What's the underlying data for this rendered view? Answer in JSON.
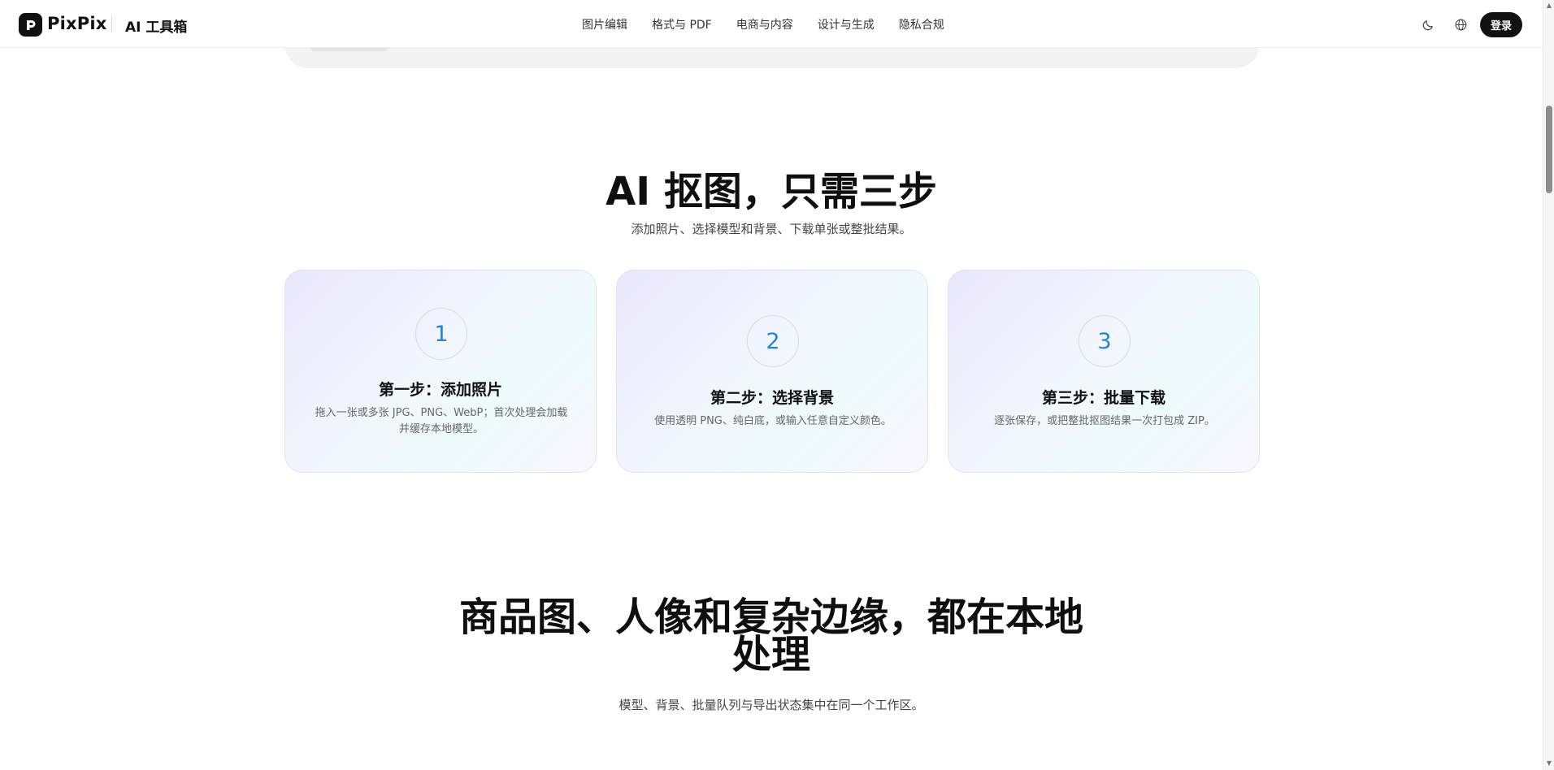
{
  "header": {
    "brand": "PixPix",
    "tools_title": "AI 工具箱",
    "nav": [
      "图片编辑",
      "格式与 PDF",
      "电商与内容",
      "设计与生成",
      "隐私合规"
    ],
    "login_label": "登录",
    "icons": [
      "moon-icon",
      "globe-icon"
    ]
  },
  "steps_section": {
    "title": "AI 抠图，只需三步",
    "subtitle": "添加照片、选择模型和背景、下载单张或整批结果。",
    "steps": [
      {
        "number": "1",
        "title": "第一步：添加照片",
        "desc_line1": "拖入一张或多张 JPG、PNG、WebP；首次处理会加载",
        "desc_line2": "并缓存本地模型。"
      },
      {
        "number": "2",
        "title": "第二步：选择背景",
        "desc_line1": "使用透明 PNG、纯白底，或输入任意自定义颜色。",
        "desc_line2": ""
      },
      {
        "number": "3",
        "title": "第三步：批量下载",
        "desc_line1": "逐张保存，或把整批抠图结果一次打包成 ZIP。",
        "desc_line2": ""
      }
    ]
  },
  "local_section": {
    "title_line1": "商品图、人像和复杂边缘，都在本地",
    "title_line2": "处理",
    "subtitle": "模型、背景、批量队列与导出状态集中在同一个工作区。"
  },
  "colors": {
    "accent_number": "#1f86d6",
    "button_bg": "#111111"
  }
}
